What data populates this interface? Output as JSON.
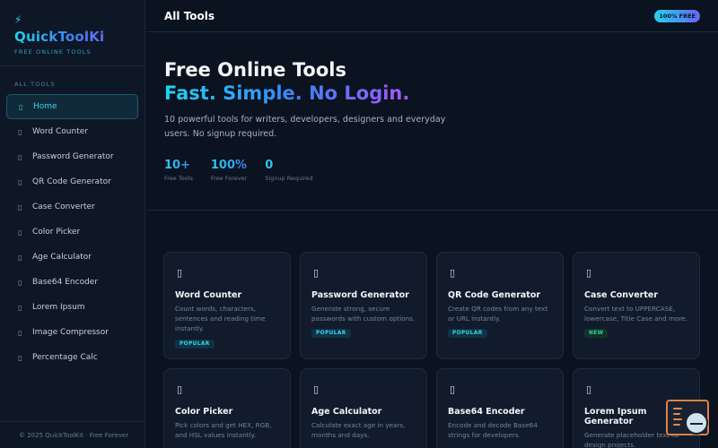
{
  "sidebar": {
    "bolt_icon": "lightning-icon",
    "logo": "QuickToolKi",
    "logo_sub": "FREE ONLINE TOOLS",
    "section_label": "ALL TOOLS",
    "items": [
      {
        "label": "Home",
        "icon": "home-icon",
        "active": true
      },
      {
        "label": "Word Counter",
        "icon": "word-counter-icon"
      },
      {
        "label": "Password Generator",
        "icon": "password-icon"
      },
      {
        "label": "QR Code Generator",
        "icon": "qr-code-icon"
      },
      {
        "label": "Case Converter",
        "icon": "case-converter-icon"
      },
      {
        "label": "Color Picker",
        "icon": "color-picker-icon"
      },
      {
        "label": "Age Calculator",
        "icon": "age-calculator-icon"
      },
      {
        "label": "Base64 Encoder",
        "icon": "base64-icon"
      },
      {
        "label": "Lorem Ipsum",
        "icon": "lorem-ipsum-icon"
      },
      {
        "label": "Image Compressor",
        "icon": "image-compressor-icon"
      },
      {
        "label": "Percentage Calc",
        "icon": "percentage-icon"
      }
    ],
    "footer": "© 2025 QuickToolKit · Free Forever"
  },
  "header": {
    "title": "All Tools",
    "badge": "100% FREE"
  },
  "hero": {
    "title": "Free Online Tools",
    "subtitle": "Fast. Simple. No Login.",
    "description": "10 powerful tools for writers, developers, designers and everyday users. No signup required.",
    "stats": [
      {
        "value": "10+",
        "label": "Free Tools"
      },
      {
        "value": "100%",
        "label": "Free Forever"
      },
      {
        "value": "0",
        "label": "Signup Required"
      }
    ]
  },
  "cards": [
    {
      "title": "Word Counter",
      "desc": "Count words, characters, sentences and reading time instantly.",
      "tag": "POPULAR",
      "tag_type": "popular",
      "icon": "word-counter-icon"
    },
    {
      "title": "Password Generator",
      "desc": "Generate strong, secure passwords with custom options.",
      "tag": "POPULAR",
      "tag_type": "popular",
      "icon": "password-icon"
    },
    {
      "title": "QR Code Generator",
      "desc": "Create QR codes from any text or URL instantly.",
      "tag": "POPULAR",
      "tag_type": "popular",
      "icon": "qr-code-icon"
    },
    {
      "title": "Case Converter",
      "desc": "Convert text to UPPERCASE, lowercase, Title Case and more.",
      "tag": "NEW",
      "tag_type": "new",
      "icon": "case-converter-icon"
    },
    {
      "title": "Color Picker",
      "desc": "Pick colors and get HEX, RGB, and HSL values instantly.",
      "icon": "color-picker-icon"
    },
    {
      "title": "Age Calculator",
      "desc": "Calculate exact age in years, months and days.",
      "icon": "age-calculator-icon"
    },
    {
      "title": "Base64 Encoder",
      "desc": "Encode and decode Base64 strings for developers.",
      "icon": "base64-icon"
    },
    {
      "title": "Lorem Ipsum Generator",
      "desc": "Generate placeholder text for design projects.",
      "icon": "lorem-ipsum-icon"
    }
  ],
  "icon_glyph": "▯",
  "floating_widget": {
    "icon": "feedback-widget-icon"
  },
  "colors": {
    "background": "#0b1220",
    "sidebar": "#0e1726",
    "accent_cyan": "#22d3ee",
    "accent_blue": "#3b82f6",
    "accent_purple": "#a855f7",
    "tag_new": "#34d399"
  }
}
